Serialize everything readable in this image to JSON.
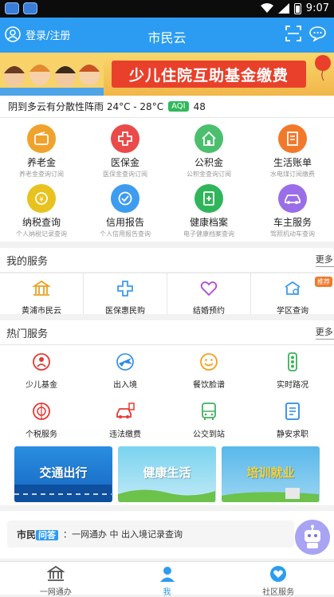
{
  "status": {
    "time": "9:07"
  },
  "header": {
    "login_label": "登录/注册",
    "title": "市民云"
  },
  "banner": {
    "text": "少儿住院互助基金缴费"
  },
  "weather": {
    "text": "阴到多云有分散性阵雨 24°C - 28°C",
    "aqi_label": "AQI",
    "aqi_value": "48"
  },
  "quick_services": [
    {
      "name": "养老金",
      "sub": "养老金查询订阅",
      "color": "#f0a32c",
      "icon": "wallet-icon"
    },
    {
      "name": "医保金",
      "sub": "医保金查询订阅",
      "color": "#ea4a4a",
      "icon": "medical-cross-icon"
    },
    {
      "name": "公积金",
      "sub": "公积金查询订阅",
      "color": "#4cbf6e",
      "icon": "house-icon"
    },
    {
      "name": "生活账单",
      "sub": "水电煤订阅缴费",
      "color": "#f2792a",
      "icon": "bill-icon"
    },
    {
      "name": "纳税查询",
      "sub": "个人纳税记录查询",
      "color": "#e8c21f",
      "icon": "tax-coin-icon"
    },
    {
      "name": "信用报告",
      "sub": "个人信用报告查询",
      "color": "#3d9cf0",
      "icon": "credit-icon"
    },
    {
      "name": "健康档案",
      "sub": "电子健康档案查询",
      "color": "#2fb55a",
      "icon": "health-record-icon"
    },
    {
      "name": "车主服务",
      "sub": "驾照机动车查询",
      "color": "#9a6ee8",
      "icon": "car-icon"
    }
  ],
  "my_services": {
    "title": "我的服务",
    "more": "更多>",
    "items": [
      {
        "label": "黄浦市民云",
        "icon": "building-icon",
        "color": "#e8a21f"
      },
      {
        "label": "医保惠民购",
        "icon": "medical-cross-icon",
        "color": "#3d9cf0"
      },
      {
        "label": "结婚预约",
        "icon": "heart-icon",
        "color": "#b04ad6"
      },
      {
        "label": "学区查询",
        "icon": "school-icon",
        "color": "#3d9cf0",
        "badge": "推荐"
      }
    ]
  },
  "hot_services": {
    "title": "热门服务",
    "more": "更多>",
    "items": [
      {
        "label": "少儿基金",
        "icon": "child-fund-icon",
        "color": "#e53935"
      },
      {
        "label": "出入境",
        "icon": "plane-icon",
        "color": "#2b8be6"
      },
      {
        "label": "餐饮脸谱",
        "icon": "smiley-icon",
        "color": "#f2a11e"
      },
      {
        "label": "实时路况",
        "icon": "traffic-light-icon",
        "color": "#3db25a"
      },
      {
        "label": "个税服务",
        "icon": "tax-seal-icon",
        "color": "#e53935"
      },
      {
        "label": "违法缴费",
        "icon": "car-fine-icon",
        "color": "#e53935"
      },
      {
        "label": "公交到站",
        "icon": "bus-icon",
        "color": "#3db25a"
      },
      {
        "label": "静安求职",
        "icon": "resume-icon",
        "color": "#2b8be6"
      }
    ]
  },
  "promo_cards": [
    {
      "label": "交通出行",
      "color": "#1f8fe0"
    },
    {
      "label": "健康生活",
      "color": "#5cc3e8"
    },
    {
      "label": "培训就业",
      "color": "#4bb0e6"
    }
  ],
  "faq": {
    "logo_a": "市民",
    "logo_b": "问答",
    "text": "：一网通办 中 出入境记录查询"
  },
  "tabs": [
    {
      "label": "一网通办",
      "icon": "government-icon",
      "active": false
    },
    {
      "label": "我",
      "icon": "person-icon",
      "active": true
    },
    {
      "label": "社区服务",
      "icon": "community-heart-icon",
      "active": false
    }
  ]
}
